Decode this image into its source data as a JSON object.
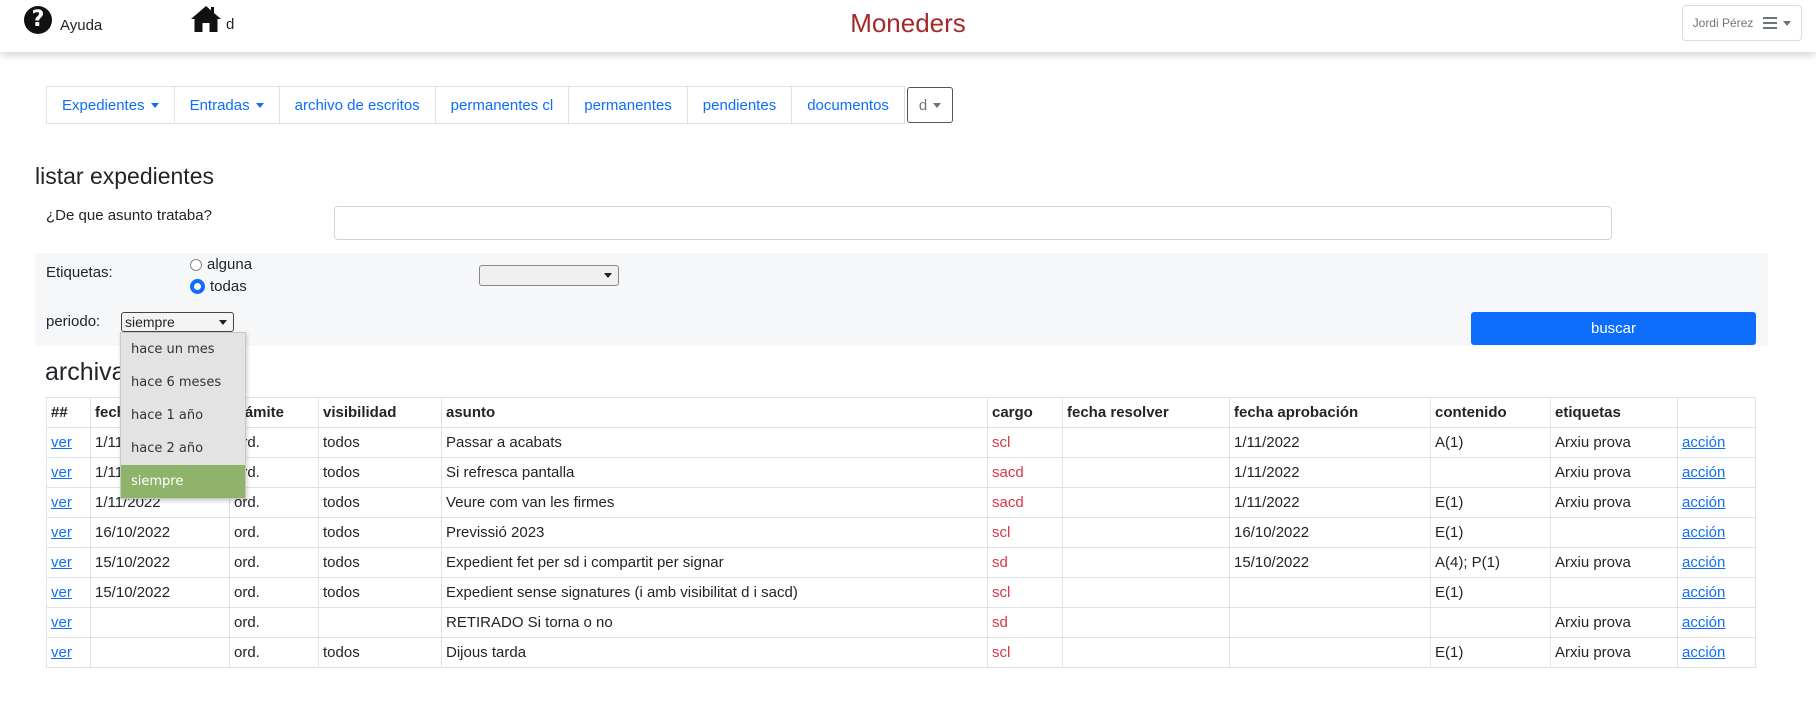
{
  "topbar": {
    "help_label": "Ayuda",
    "home_label": "d",
    "brand": "Moneders",
    "user": "Jordi Pérez"
  },
  "tabs": [
    {
      "label": "Expedientes",
      "dropdown": true
    },
    {
      "label": "Entradas",
      "dropdown": true
    },
    {
      "label": "archivo de escritos"
    },
    {
      "label": "permanentes cl"
    },
    {
      "label": "permanentes"
    },
    {
      "label": "pendientes"
    },
    {
      "label": "documentos"
    },
    {
      "label": "d",
      "dropdown": true
    }
  ],
  "page_title": "listar expedientes",
  "form": {
    "question_label": "¿De que asunto trataba?",
    "question_value": "",
    "etiquetas_label": "Etiquetas:",
    "radio_alguna": "alguna",
    "radio_todas": "todas",
    "radio_selected": "todas",
    "etiquetas_select_value": "",
    "periodo_label": "periodo:",
    "periodo_value": "siempre",
    "periodo_options": [
      "hace un mes",
      "hace 6 meses",
      "hace 1 año",
      "hace 2 año",
      "siempre"
    ],
    "buscar_label": "buscar"
  },
  "archive_title": "archivados",
  "table": {
    "headers": [
      "##",
      "fecha",
      "trámite",
      "visibilidad",
      "asunto",
      "cargo",
      "fecha resolver",
      "fecha aprobación",
      "contenido",
      "etiquetas",
      ""
    ],
    "rows": [
      {
        "ver": "ver",
        "fecha": "1/11/2022",
        "tramite": "ord.",
        "visibilidad": "todos",
        "asunto": "Passar a acabats",
        "cargo": "scl",
        "fecha_resolver": "",
        "fecha_aprobacion": "1/11/2022",
        "contenido": "A(1)",
        "etiquetas": "Arxiu prova",
        "accion": "acción"
      },
      {
        "ver": "ver",
        "fecha": "1/11/2022",
        "tramite": "ord.",
        "visibilidad": "todos",
        "asunto": "Si refresca pantalla",
        "cargo": "sacd",
        "fecha_resolver": "",
        "fecha_aprobacion": "1/11/2022",
        "contenido": "",
        "etiquetas": "Arxiu prova",
        "accion": "acción"
      },
      {
        "ver": "ver",
        "fecha": "1/11/2022",
        "tramite": "ord.",
        "visibilidad": "todos",
        "asunto": "Veure com van les firmes",
        "cargo": "sacd",
        "fecha_resolver": "",
        "fecha_aprobacion": "1/11/2022",
        "contenido": "E(1)",
        "etiquetas": "Arxiu prova",
        "accion": "acción"
      },
      {
        "ver": "ver",
        "fecha": "16/10/2022",
        "tramite": "ord.",
        "visibilidad": "todos",
        "asunto": "Previssió 2023",
        "cargo": "scl",
        "fecha_resolver": "",
        "fecha_aprobacion": "16/10/2022",
        "contenido": "E(1)",
        "etiquetas": "",
        "accion": "acción"
      },
      {
        "ver": "ver",
        "fecha": "15/10/2022",
        "tramite": "ord.",
        "visibilidad": "todos",
        "asunto": "Expedient fet per sd i compartit per signar",
        "cargo": "sd",
        "fecha_resolver": "",
        "fecha_aprobacion": "15/10/2022",
        "contenido": "A(4); P(1)",
        "etiquetas": "Arxiu prova",
        "accion": "acción"
      },
      {
        "ver": "ver",
        "fecha": "15/10/2022",
        "tramite": "ord.",
        "visibilidad": "todos",
        "asunto": "Expedient sense signatures (i amb visibilitat d i sacd)",
        "cargo": "scl",
        "fecha_resolver": "",
        "fecha_aprobacion": "",
        "contenido": "E(1)",
        "etiquetas": "",
        "accion": "acción"
      },
      {
        "ver": "ver",
        "fecha": "",
        "tramite": "ord.",
        "visibilidad": "",
        "asunto": "RETIRADO Si torna o no",
        "cargo": "sd",
        "fecha_resolver": "",
        "fecha_aprobacion": "",
        "contenido": "",
        "etiquetas": "Arxiu prova",
        "accion": "acción"
      },
      {
        "ver": "ver",
        "fecha": "",
        "tramite": "ord.",
        "visibilidad": "todos",
        "asunto": "Dijous tarda",
        "cargo": "scl",
        "fecha_resolver": "",
        "fecha_aprobacion": "",
        "contenido": "E(1)",
        "etiquetas": "Arxiu prova",
        "accion": "acción"
      }
    ]
  },
  "colors": {
    "brand": "#a52a2a",
    "primary": "#0d6efd",
    "cargo": "#dc3545",
    "option_selected": "#8fb36a"
  }
}
